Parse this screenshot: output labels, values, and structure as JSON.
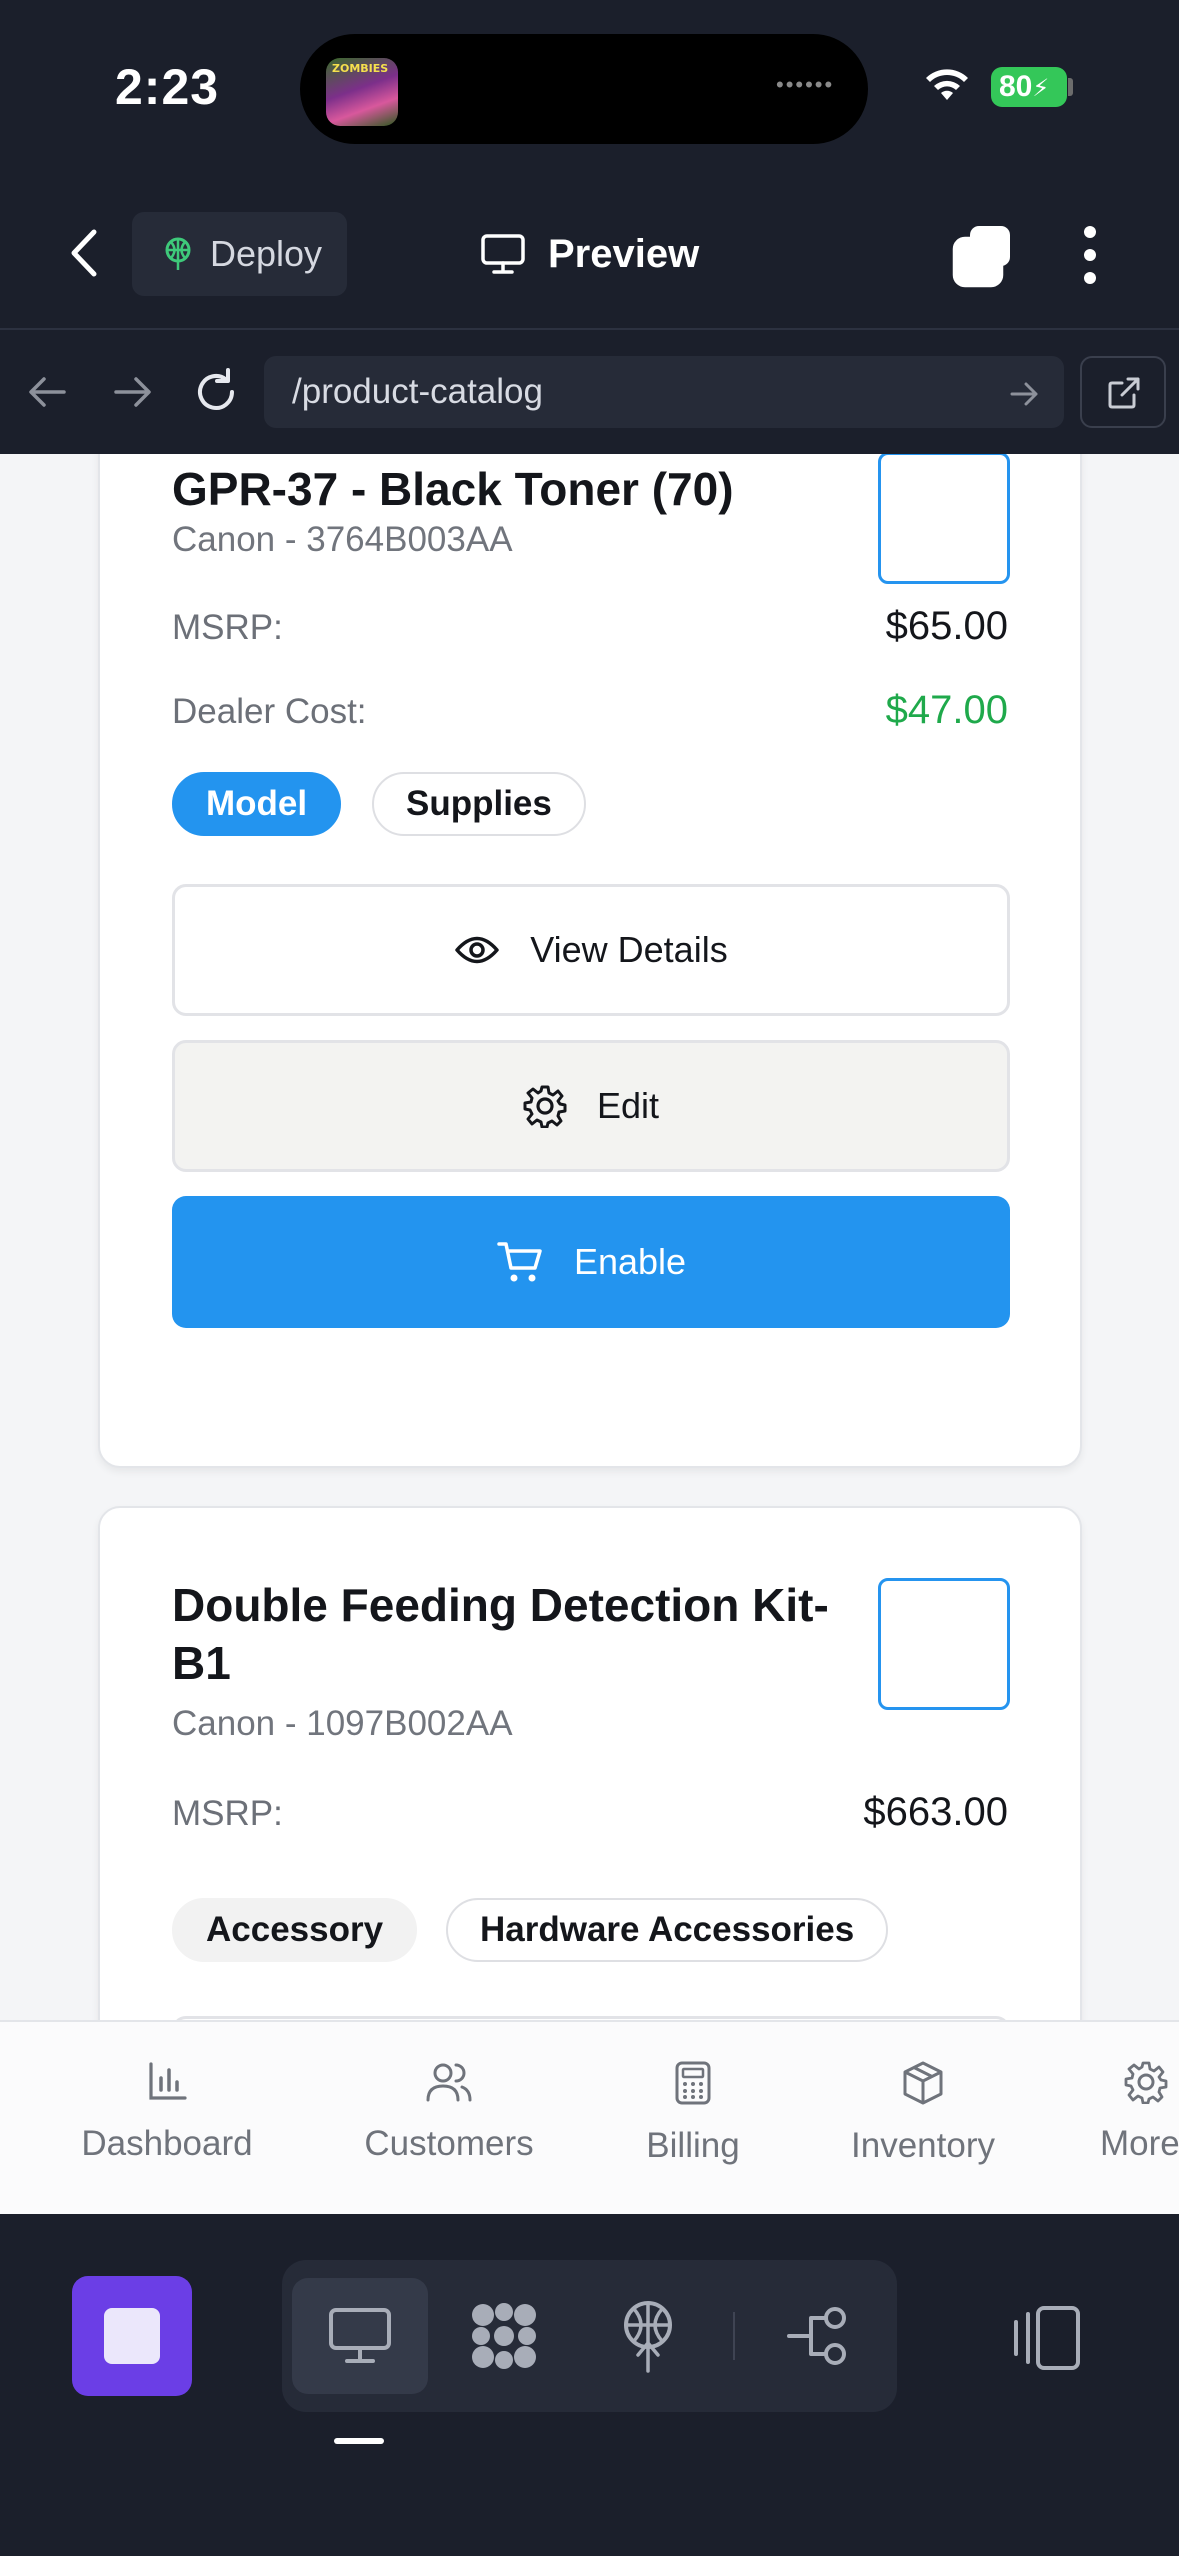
{
  "status_bar": {
    "time": "2:23",
    "island_art_text": "ZOMBIES",
    "battery": "80"
  },
  "topbar": {
    "deploy_label": "Deploy",
    "preview_label": "Preview"
  },
  "urlbar": {
    "url": "/product-catalog"
  },
  "products": [
    {
      "title": "GPR-37 - Black Toner (70)",
      "subtitle": "Canon - 3764B003AA",
      "msrp_label": "MSRP:",
      "msrp": "$65.00",
      "dealer_label": "Dealer Cost:",
      "dealer_cost": "$47.00",
      "tags": [
        "Model",
        "Supplies"
      ],
      "view_label": "View Details",
      "edit_label": "Edit",
      "enable_label": "Enable"
    },
    {
      "title_line1": "Double Feeding Detection Kit-",
      "title_line2": "B1",
      "subtitle": "Canon - 1097B002AA",
      "msrp_label": "MSRP:",
      "msrp": "$663.00",
      "tags": [
        "Accessory",
        "Hardware Accessories"
      ]
    }
  ],
  "tabbar": {
    "items": [
      {
        "label": "Dashboard",
        "icon": "bar-chart-icon"
      },
      {
        "label": "Customers",
        "icon": "users-icon"
      },
      {
        "label": "Billing",
        "icon": "calculator-icon"
      },
      {
        "label": "Inventory",
        "icon": "package-icon"
      },
      {
        "label": "More",
        "icon": "gear-icon"
      }
    ]
  },
  "colors": {
    "accent": "#2394ef",
    "green": "#1fa94b",
    "dark_bg": "#1b1f2b",
    "stop_purple": "#6b3ee6"
  }
}
